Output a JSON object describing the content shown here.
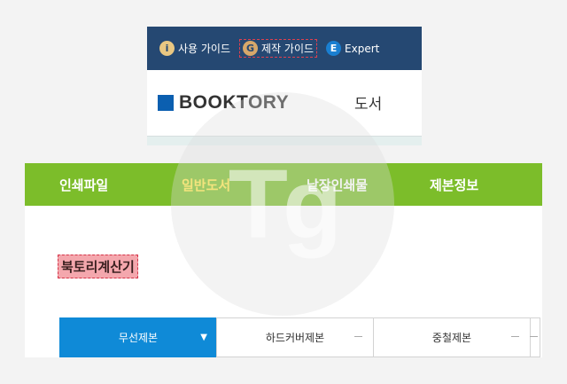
{
  "guide_bar": {
    "items": [
      {
        "icon": "i",
        "label": "사용 가이드"
      },
      {
        "icon": "G",
        "label": "제작 가이드"
      },
      {
        "icon": "E",
        "label": "Expert"
      }
    ]
  },
  "header": {
    "logo_text": "BOOKTORY",
    "nav_visible": "도서"
  },
  "main_menu": {
    "items": [
      "인쇄파일",
      "일반도서",
      "낱장인쇄물",
      "제본정보"
    ],
    "active_index": 1
  },
  "content": {
    "title": "북토리계산기",
    "tabs": [
      "무선제본",
      "하드커버제본",
      "중철제본"
    ],
    "active_tab_index": 0
  },
  "watermark": "Tg",
  "colors": {
    "guide_bar_bg": "#254872",
    "menu_green": "#7cbd2a",
    "menu_active_text": "#ffe94a",
    "tab_active_bg": "#0f8ad7",
    "logo_square": "#0b5fb0",
    "highlight": "#d5364a"
  }
}
